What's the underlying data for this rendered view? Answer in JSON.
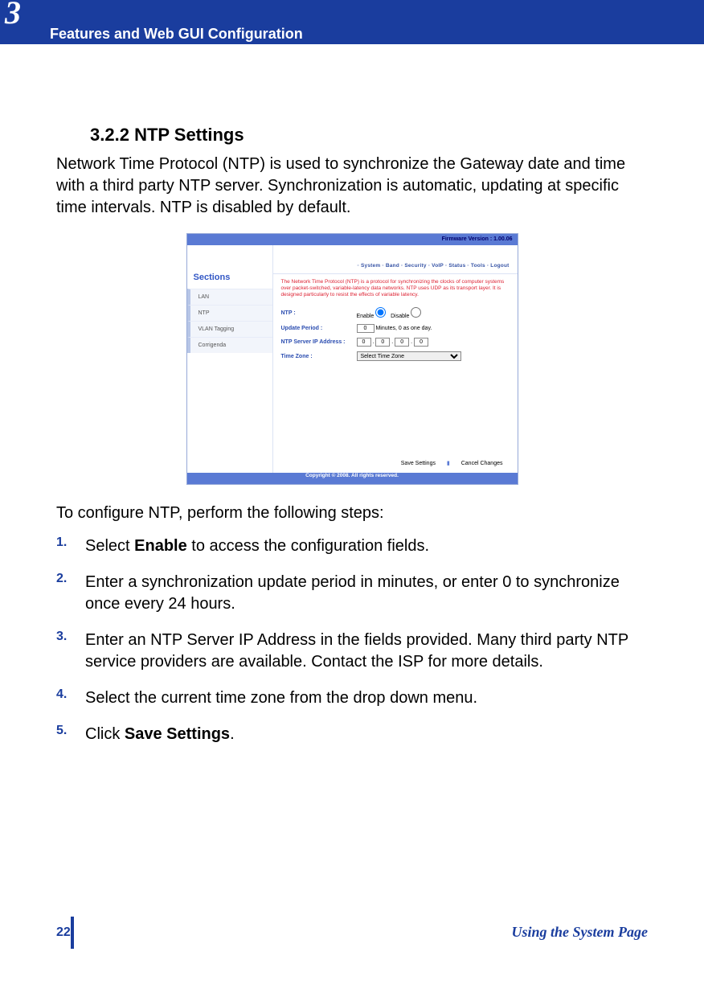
{
  "chapter_number": "3",
  "header_title": "Features and Web GUI Configuration",
  "section": {
    "number": "3.2.2",
    "title": "NTP Settings",
    "body": "Network Time Protocol (NTP) is used to synchronize the Gateway date and time with a third party NTP server. Synchronization is automatic, updating at specific time intervals. NTP is disabled by default."
  },
  "screenshot": {
    "firmware": "Firmware Version : 1.00.06",
    "sections_label": "Sections",
    "side_items": {
      "a": "LAN",
      "b": "NTP",
      "c": "VLAN Tagging",
      "d": "Corrigenda"
    },
    "nav": "◦ System   ◦ Band   ◦ Security   ◦ VoIP   ◦ Status   ◦ Tools   ◦ Logout",
    "blurb": "The Network Time Protocol (NTP) is a protocol for synchronizing the clocks of computer systems over packet-switched, variable-latency data networks. NTP uses UDP as its transport layer. It is designed particularly to resist the effects of variable latency.",
    "labels": {
      "ntp": "NTP :",
      "update": "Update Period :",
      "server": "NTP Server IP Address :",
      "tz": "Time Zone :"
    },
    "values": {
      "enable_label": "Enable",
      "disable_label": "Disable",
      "update_val": "0",
      "update_suffix": "Minutes, 0 as one day.",
      "ip": {
        "a": "0",
        "b": "0",
        "c": "0",
        "d": "0"
      },
      "tz_option": "Select Time Zone"
    },
    "buttons": {
      "save": "Save Settings",
      "cancel": "Cancel Changes"
    },
    "copyright": "Copyright © 2008.  All rights reserved."
  },
  "intro2": "To configure NTP, perform the following steps:",
  "steps": {
    "s1a": "Select ",
    "s1b": "Enable",
    "s1c": " to access the configuration fields.",
    "s2": "Enter a synchronization update period in minutes, or enter 0 to synchronize once every 24 hours.",
    "s3": "Enter an NTP Server IP Address in the fields provided. Many third party NTP service providers are available. Contact the ISP for more details.",
    "s4": "Select the current time zone from the drop down menu.",
    "s5a": "Click ",
    "s5b": "Save Settings",
    "s5c": "."
  },
  "footer": {
    "page": "22",
    "title": "Using the System Page"
  }
}
